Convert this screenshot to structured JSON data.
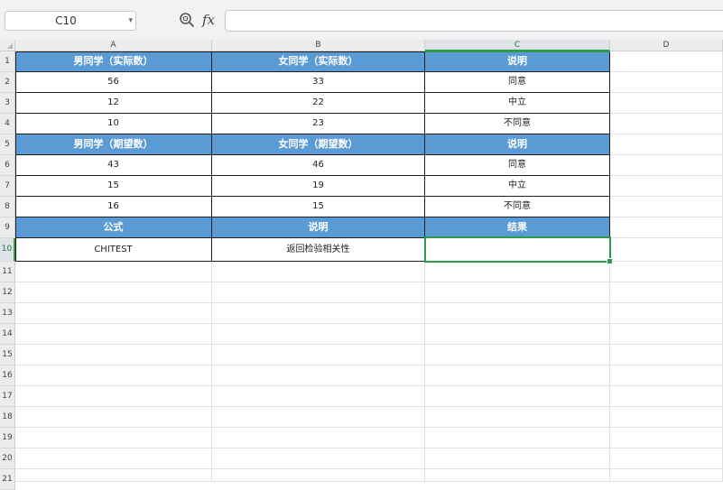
{
  "name_box": {
    "value": "C10"
  },
  "formula_bar": {
    "fx_label": "fx",
    "value": ""
  },
  "columns": [
    {
      "label": "A",
      "active": false
    },
    {
      "label": "B",
      "active": false
    },
    {
      "label": "C",
      "active": true
    },
    {
      "label": "D",
      "active": false
    }
  ],
  "rows": [
    "1",
    "2",
    "3",
    "4",
    "5",
    "6",
    "7",
    "8",
    "9",
    "10",
    "11",
    "12",
    "13",
    "14",
    "15",
    "16",
    "17",
    "18",
    "19",
    "20",
    "21"
  ],
  "active_row": "10",
  "table": [
    {
      "header": true,
      "cells": [
        "男同学（实际数）",
        "女同学（实际数）",
        "说明"
      ]
    },
    {
      "header": false,
      "cells": [
        "56",
        "33",
        "同意"
      ]
    },
    {
      "header": false,
      "cells": [
        "12",
        "22",
        "中立"
      ]
    },
    {
      "header": false,
      "cells": [
        "10",
        "23",
        "不同意"
      ]
    },
    {
      "header": true,
      "cells": [
        "男同学（期望数）",
        "女同学（期望数）",
        "说明"
      ]
    },
    {
      "header": false,
      "cells": [
        "43",
        "46",
        "同意"
      ]
    },
    {
      "header": false,
      "cells": [
        "15",
        "19",
        "中立"
      ]
    },
    {
      "header": false,
      "cells": [
        "16",
        "15",
        "不同意"
      ]
    },
    {
      "header": true,
      "cells": [
        "公式",
        "说明",
        "结果"
      ]
    },
    {
      "header": false,
      "cells": [
        "CHITEST",
        "返回检验相关性",
        ""
      ]
    }
  ],
  "colors": {
    "header_fill": "#5b9bd5",
    "selection": "#2a9b46",
    "grid": "#e1e1e1"
  },
  "icons": {
    "zoom": "zoom-search-icon",
    "name_box_dropdown": "chevron-down-icon",
    "select_all": "select-all-triangle-icon"
  }
}
